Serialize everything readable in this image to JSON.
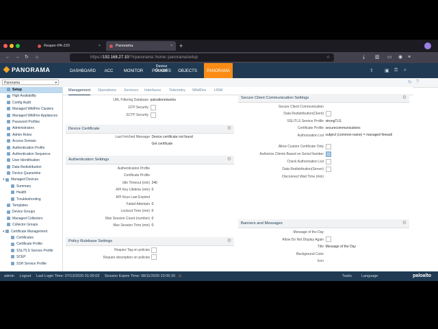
{
  "browser": {
    "tabs": [
      {
        "title": "Reaper-PA-220"
      },
      {
        "title": "Panorama"
      }
    ],
    "url_prefix": "https://",
    "url_host": "192.168.27.10",
    "url_path": "/?#panorama::home::panorama/setup"
  },
  "app": {
    "logo": "PANORAMA",
    "nav": [
      "DASHBOARD",
      "ACC",
      "MONITOR",
      "POLICIES",
      "OBJECTS",
      "PANORAMA"
    ],
    "device_groups_label": "Device Groups",
    "context": "Panorama"
  },
  "sidebar": {
    "items": [
      {
        "label": "Setup",
        "indent": 1,
        "selected": true
      },
      {
        "label": "High Availability",
        "indent": 1
      },
      {
        "label": "Config Audit",
        "indent": 1
      },
      {
        "label": "Managed WildFire Clusters",
        "indent": 1
      },
      {
        "label": "Managed WildFire Appliances",
        "indent": 1
      },
      {
        "label": "Password Profiles",
        "indent": 1
      },
      {
        "label": "Administrators",
        "indent": 1
      },
      {
        "label": "Admin Roles",
        "indent": 1
      },
      {
        "label": "Access Domain",
        "indent": 1
      },
      {
        "label": "Authentication Profile",
        "indent": 1
      },
      {
        "label": "Authentication Sequence",
        "indent": 1
      },
      {
        "label": "User Identification",
        "indent": 1
      },
      {
        "label": "Data Redistribution",
        "indent": 1
      },
      {
        "label": "Device Quarantine",
        "indent": 1
      },
      {
        "label": "Managed Devices",
        "indent": 0,
        "toggle": "▾"
      },
      {
        "label": "Summary",
        "indent": 2
      },
      {
        "label": "Health",
        "indent": 2
      },
      {
        "label": "Troubleshooting",
        "indent": 2
      },
      {
        "label": "Templates",
        "indent": 1
      },
      {
        "label": "Device Groups",
        "indent": 1
      },
      {
        "label": "Managed Collectors",
        "indent": 1
      },
      {
        "label": "Collector Groups",
        "indent": 1
      },
      {
        "label": "Certificate Management",
        "indent": 0,
        "toggle": "▾"
      },
      {
        "label": "Certificates",
        "indent": 2
      },
      {
        "label": "Certificate Profile",
        "indent": 2
      },
      {
        "label": "SSL/TLS Service Profile",
        "indent": 2
      },
      {
        "label": "SCEP",
        "indent": 2
      },
      {
        "label": "SSH Service Profile",
        "indent": 2
      }
    ]
  },
  "subtabs": [
    "Management",
    "Operations",
    "Services",
    "Interfaces",
    "Telemetry",
    "WildFire",
    "HSM"
  ],
  "top_rows": [
    {
      "label": "URL Filtering Database",
      "value": "paloaltonetworks"
    },
    {
      "label": "GTP Security",
      "checkbox": false
    },
    {
      "label": "SCTP Security",
      "checkbox": false
    }
  ],
  "device_certificate": {
    "title": "Device Certificate",
    "rows": [
      {
        "label": "Last Fetched Message",
        "value": "Device certificate not found"
      }
    ],
    "link": "Get certificate"
  },
  "authentication": {
    "title": "Authentication Settings",
    "rows": [
      {
        "label": "Authentication Profile",
        "value": ""
      },
      {
        "label": "Certificate Profile",
        "value": ""
      },
      {
        "label": "Idle Timeout (min)",
        "value": "240"
      },
      {
        "label": "API Key Lifetime (min)",
        "value": "0"
      },
      {
        "label": "API Keys Last Expired",
        "value": ""
      },
      {
        "label": "Failed Attempts",
        "value": "0"
      },
      {
        "label": "Lockout Time (min)",
        "value": "0"
      },
      {
        "label": "Max Session Count (number)",
        "value": "0"
      },
      {
        "label": "Max Session Time (min)",
        "value": "0"
      }
    ]
  },
  "policy_rulebase": {
    "title": "Policy Rulebase Settings",
    "rows": [
      {
        "label": "Require Tag on policies",
        "checkbox": false
      },
      {
        "label": "Require description on policies",
        "checkbox": false
      }
    ]
  },
  "secure_client": {
    "title": "Secure Client Communication Settings",
    "rows": [
      {
        "label": "Secure Client Communication",
        "value": ""
      },
      {
        "label": "Data Redistribution(Client)",
        "checkbox": false
      },
      {
        "label": "SSL/TLS Service Profile",
        "value": "strongTLS"
      },
      {
        "label": "Certificate Profile",
        "value": "securecommunications"
      },
      {
        "label": "Authorization List",
        "value": "subject (common-name) = managed firewall"
      },
      {
        "label": "Allow Custom Certificate Only",
        "checkbox": false
      },
      {
        "label": "Authorize Clients Based on Serial Number",
        "checkbox": true
      },
      {
        "label": "Check Authorization List",
        "checkbox": false
      },
      {
        "label": "Data Redistribution(Server)",
        "checkbox": false
      },
      {
        "label": "Disconnect Wait Time (min)",
        "value": ""
      }
    ]
  },
  "banners": {
    "title": "Banners and Messages",
    "rows": [
      {
        "label": "Message of the Day",
        "value": ""
      },
      {
        "label": "Allow Do Not Display Again",
        "checkbox": false
      },
      {
        "label": "Title",
        "value": "Message of the Day"
      },
      {
        "label": "Background Color",
        "value": ""
      },
      {
        "label": "Icon",
        "value": ""
      }
    ]
  },
  "status": {
    "user": "admin",
    "logout": "Logout",
    "last_login": "Last Login Time: 07/12/2020 01:00:03",
    "session_expire": "Session Expire Time: 08/11/2020 23:05:30",
    "tasks": "Tasks",
    "language": "Language",
    "brand": "paloalto"
  },
  "colors": {
    "header": "#1f3a52",
    "accent": "#fa8c16",
    "selected": "#bfd9ef"
  }
}
